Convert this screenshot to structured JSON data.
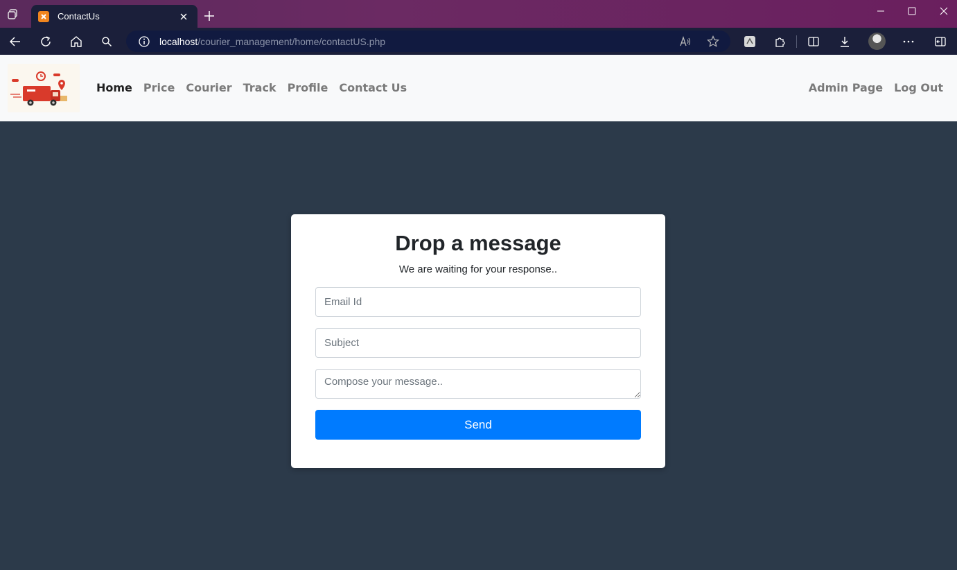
{
  "browser": {
    "tab_title": "ContactUs",
    "url_host": "localhost",
    "url_path": "/courier_management/home/contactUS.php"
  },
  "navbar": {
    "links": [
      "Home",
      "Price",
      "Courier",
      "Track",
      "Profile",
      "Contact Us"
    ],
    "active": "Home",
    "right_links": [
      "Admin Page",
      "Log Out"
    ]
  },
  "form": {
    "heading": "Drop a message",
    "subheading": "We are waiting for your response..",
    "email_placeholder": "Email Id",
    "subject_placeholder": "Subject",
    "message_placeholder": "Compose your message..",
    "send_label": "Send"
  },
  "colors": {
    "page_bg": "#2c3a4a",
    "primary": "#007bff",
    "tab_gradient": "#5a2a5c"
  }
}
